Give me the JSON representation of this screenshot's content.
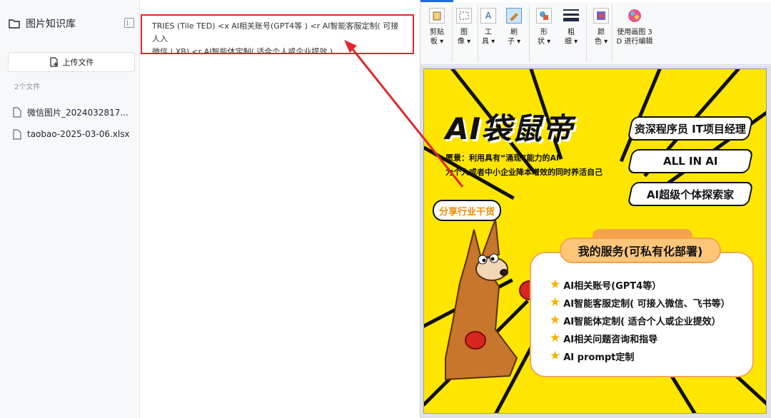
{
  "sidebar": {
    "title": "图片知识库",
    "upload_label": "上传文件",
    "file_count": "2个文件",
    "files": [
      "微信图片_2024032817...",
      "taobao-2025-03-06.xlsx"
    ]
  },
  "main": {
    "text_line1": "TRIES (Tile TED) <x AI相关账号(GPT4等 ) <r AI智能客服定制( 可接人入",
    "text_line2": "微信 | XB) <r AI智能体定制( 适合个人或企业提效 )"
  },
  "paint": {
    "tools": [
      {
        "line1": "剪贴",
        "line2": "板 ▾"
      },
      {
        "line1": "图",
        "line2": "像 ▾"
      },
      {
        "line1": "工",
        "line2": "具 ▾"
      },
      {
        "line1": "刷",
        "line2": "子 ▾"
      },
      {
        "line1": "形",
        "line2": "状 ▾"
      },
      {
        "line1": "粗",
        "line2": "细 ▾"
      },
      {
        "line1": "颜",
        "line2": "色 ▾"
      },
      {
        "line1": "使用画图 3",
        "line2": "D 进行编辑"
      }
    ]
  },
  "poster": {
    "title": "AI袋鼠帝",
    "vision1": "愿景：利用具有“涌现”能力的AI",
    "vision2": "为个人或者中小企业降本增效的同时养活自己",
    "tag1": "资深程序员  IT项目经理",
    "tag2": "ALL IN AI",
    "tag3": "AI超级个体探索家",
    "bubble": "分享行业干货",
    "services_title": "我的服务(可私有化部署)",
    "services": [
      "AI相关账号(GPT4等）",
      "AI智能客服定制( 可接入微信、飞书等）",
      "AI智能体定制( 适合个人或企业提效）",
      "AI相关问题咨询和指导",
      "AI  prompt定制"
    ]
  },
  "colors": {
    "highlight_border": "#e0282e",
    "poster_bg": "#ffe600",
    "accent": "#f6a24a"
  }
}
